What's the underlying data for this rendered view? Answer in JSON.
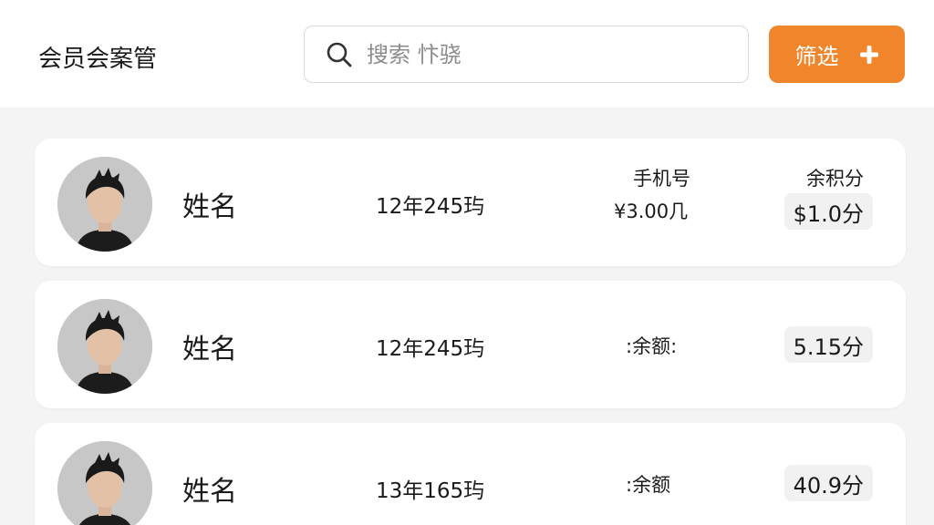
{
  "header": {
    "title": "会员会案管",
    "search": {
      "placeholder": "搜索 忭骁",
      "value": ""
    },
    "filter_label": "筛选"
  },
  "icons": {
    "search": "search-icon",
    "add": "plus-icon",
    "avatar": "user-avatar"
  },
  "colors": {
    "accent": "#f0852b",
    "background": "#f4f4f4",
    "card": "#ffffff",
    "badge": "#f1f1f1"
  },
  "members": [
    {
      "name": "姓名",
      "date": "12年245玙",
      "col3_label": "手机号",
      "col3_value": "¥3.00几",
      "col4_label": "余积分",
      "badge": "$1.0分"
    },
    {
      "name": "姓名",
      "date": "12年245玙",
      "col3_label": ":余额:",
      "badge": "5.15分"
    },
    {
      "name": "姓名",
      "date": "13年165玙",
      "col3_label": ":余额",
      "badge": "40.9分"
    }
  ]
}
